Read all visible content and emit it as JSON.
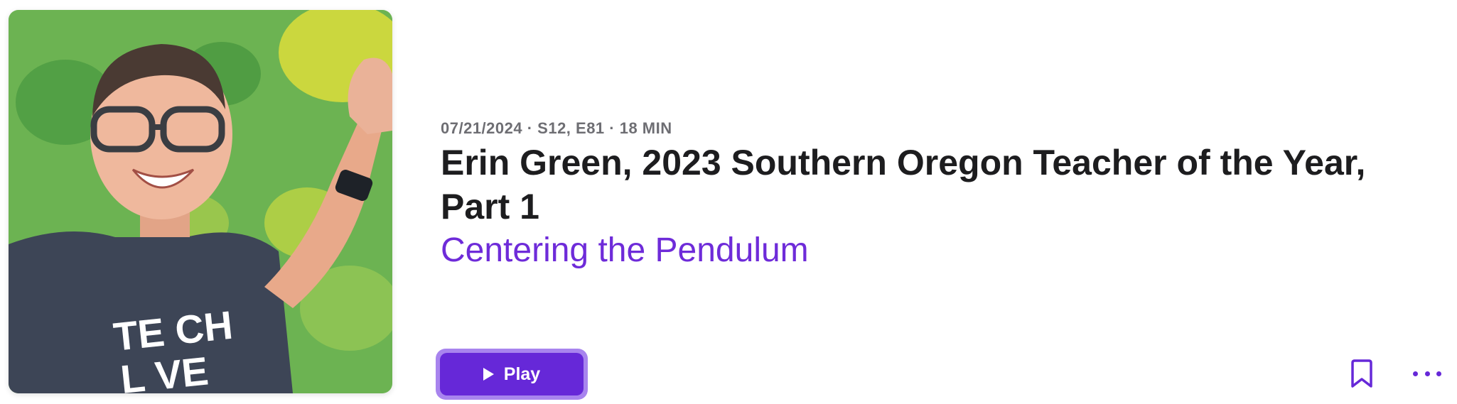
{
  "episode": {
    "meta": "07/21/2024 · S12, E81 · 18 MIN",
    "title": "Erin Green, 2023 Southern Oregon Teacher of the Year, Part 1",
    "show_name": "Centering the Pendulum",
    "artwork_shirt_text_line1": "TE CH",
    "artwork_shirt_text_line2": "L VE"
  },
  "actions": {
    "play_label": "Play",
    "play_icon": "play-icon",
    "bookmark_icon": "bookmark-icon",
    "more_icon": "more-icon"
  },
  "colors": {
    "accent": "#6628d8",
    "accent_light": "#a884ee",
    "meta_gray": "#6e6e73",
    "title_text": "#1d1d1f"
  }
}
